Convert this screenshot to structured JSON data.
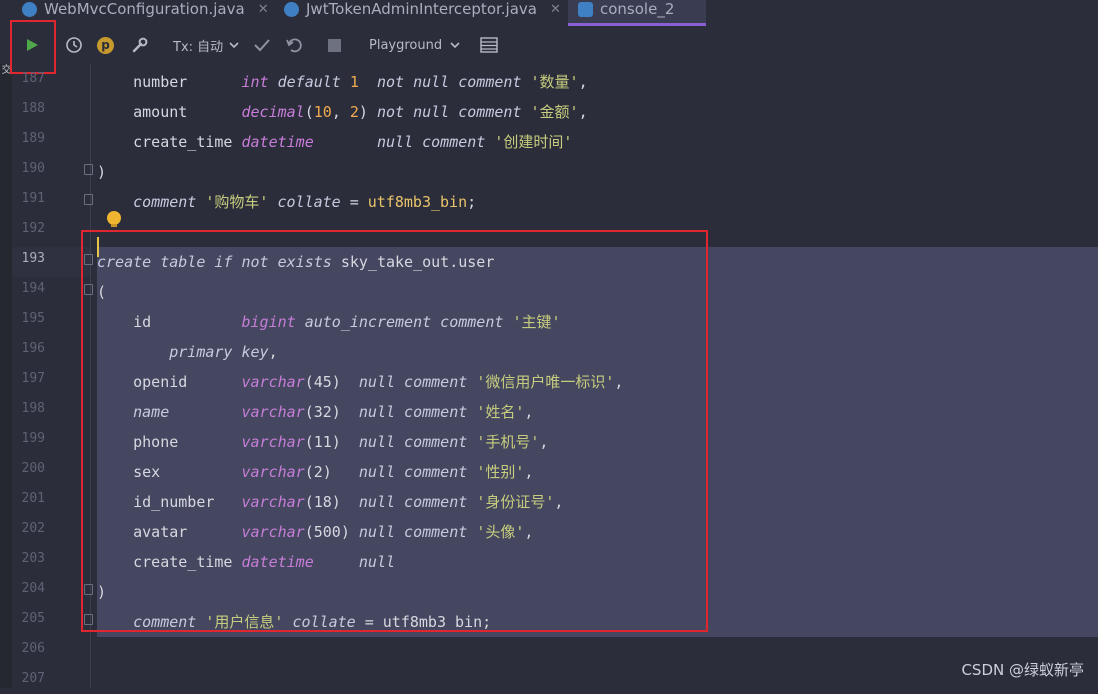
{
  "tabs": [
    {
      "label": "WebMvcConfiguration.java",
      "active": false
    },
    {
      "label": "JwtTokenAdminInterceptor.java",
      "active": false
    },
    {
      "label": "console_2",
      "active": true
    }
  ],
  "left_panel": {
    "label": "提交"
  },
  "toolbar": {
    "run_icon": "play-icon",
    "history_icon": "clock-icon",
    "profile_badge": "p",
    "settings_icon": "wrench-icon",
    "tx_label": "Tx: 自动",
    "commit_icon": "check-icon",
    "rollback_icon": "undo-icon",
    "stop_icon": "stop-icon",
    "mode_label": "Playground",
    "grid_icon": "table-icon"
  },
  "colors": {
    "accent": "#8a5fd6",
    "highlight_box": "#e0262f",
    "selection": "#44475f"
  },
  "editor": {
    "lines": [
      {
        "n": "187",
        "tokens": [
          [
            "plain",
            "    number      "
          ],
          [
            "ty",
            "int"
          ],
          [
            "kwi",
            " default "
          ],
          [
            "num",
            "1"
          ],
          [
            "kwi",
            "  not null comment "
          ],
          [
            "str",
            "'数量'"
          ],
          [
            "plain",
            ","
          ]
        ]
      },
      {
        "n": "188",
        "tokens": [
          [
            "plain",
            "    amount      "
          ],
          [
            "ty",
            "decimal"
          ],
          [
            "plain",
            "("
          ],
          [
            "num",
            "10"
          ],
          [
            "plain",
            ", "
          ],
          [
            "num",
            "2"
          ],
          [
            "plain",
            ") "
          ],
          [
            "kwi",
            "not null comment "
          ],
          [
            "str",
            "'金额'"
          ],
          [
            "plain",
            ","
          ]
        ]
      },
      {
        "n": "189",
        "tokens": [
          [
            "plain",
            "    create_time "
          ],
          [
            "ty",
            "datetime"
          ],
          [
            "kwi",
            "       null comment "
          ],
          [
            "str",
            "'创建时间'"
          ]
        ]
      },
      {
        "n": "190",
        "tokens": [
          [
            "plain",
            ")"
          ]
        ]
      },
      {
        "n": "191",
        "tokens": [
          [
            "kwi",
            "    comment "
          ],
          [
            "str",
            "'购物车'"
          ],
          [
            "kwi",
            " collate "
          ],
          [
            "plain",
            "= "
          ],
          [
            "fn",
            "utf8mb3_bin"
          ],
          [
            "plain",
            ";"
          ]
        ]
      },
      {
        "n": "192",
        "tokens": []
      },
      {
        "n": "193",
        "tokens": [
          [
            "kwi",
            "create table if not exists "
          ],
          [
            "plain",
            "sky_take_out.user"
          ]
        ]
      },
      {
        "n": "194",
        "tokens": [
          [
            "plain",
            "("
          ]
        ]
      },
      {
        "n": "195",
        "tokens": [
          [
            "plain",
            "    id          "
          ],
          [
            "ty",
            "bigint"
          ],
          [
            "kwi",
            " auto_increment comment "
          ],
          [
            "str",
            "'主键'"
          ]
        ]
      },
      {
        "n": "196",
        "tokens": [
          [
            "kwi",
            "        primary key"
          ],
          [
            "plain",
            ","
          ]
        ]
      },
      {
        "n": "197",
        "tokens": [
          [
            "plain",
            "    openid      "
          ],
          [
            "ty",
            "varchar"
          ],
          [
            "plain",
            "(45)  "
          ],
          [
            "kwi",
            "null comment "
          ],
          [
            "str",
            "'微信用户唯一标识'"
          ],
          [
            "plain",
            ","
          ]
        ]
      },
      {
        "n": "198",
        "tokens": [
          [
            "kwi",
            "    name        "
          ],
          [
            "ty",
            "varchar"
          ],
          [
            "plain",
            "(32)  "
          ],
          [
            "kwi",
            "null comment "
          ],
          [
            "str",
            "'姓名'"
          ],
          [
            "plain",
            ","
          ]
        ]
      },
      {
        "n": "199",
        "tokens": [
          [
            "plain",
            "    phone       "
          ],
          [
            "ty",
            "varchar"
          ],
          [
            "plain",
            "(11)  "
          ],
          [
            "kwi",
            "null comment "
          ],
          [
            "str",
            "'手机号'"
          ],
          [
            "plain",
            ","
          ]
        ]
      },
      {
        "n": "200",
        "tokens": [
          [
            "plain",
            "    sex         "
          ],
          [
            "ty",
            "varchar"
          ],
          [
            "plain",
            "(2)   "
          ],
          [
            "kwi",
            "null comment "
          ],
          [
            "str",
            "'性别'"
          ],
          [
            "plain",
            ","
          ]
        ]
      },
      {
        "n": "201",
        "tokens": [
          [
            "plain",
            "    id_number   "
          ],
          [
            "ty",
            "varchar"
          ],
          [
            "plain",
            "(18)  "
          ],
          [
            "kwi",
            "null comment "
          ],
          [
            "str",
            "'身份证号'"
          ],
          [
            "plain",
            ","
          ]
        ]
      },
      {
        "n": "202",
        "tokens": [
          [
            "plain",
            "    avatar      "
          ],
          [
            "ty",
            "varchar"
          ],
          [
            "plain",
            "(500) "
          ],
          [
            "kwi",
            "null comment "
          ],
          [
            "str",
            "'头像'"
          ],
          [
            "plain",
            ","
          ]
        ]
      },
      {
        "n": "203",
        "tokens": [
          [
            "plain",
            "    create_time "
          ],
          [
            "ty",
            "datetime"
          ],
          [
            "kwi",
            "     null"
          ]
        ]
      },
      {
        "n": "204",
        "tokens": [
          [
            "plain",
            ")"
          ]
        ]
      },
      {
        "n": "205",
        "tokens": [
          [
            "kwi",
            "    comment "
          ],
          [
            "str",
            "'用户信息'"
          ],
          [
            "kwi",
            " collate "
          ],
          [
            "plain",
            "= "
          ],
          [
            "plain",
            "utf8mb3_bin"
          ],
          [
            "plain",
            ";"
          ]
        ]
      },
      {
        "n": "206",
        "tokens": []
      },
      {
        "n": "207",
        "tokens": []
      }
    ]
  },
  "watermark": "CSDN @绿蚁新亭"
}
